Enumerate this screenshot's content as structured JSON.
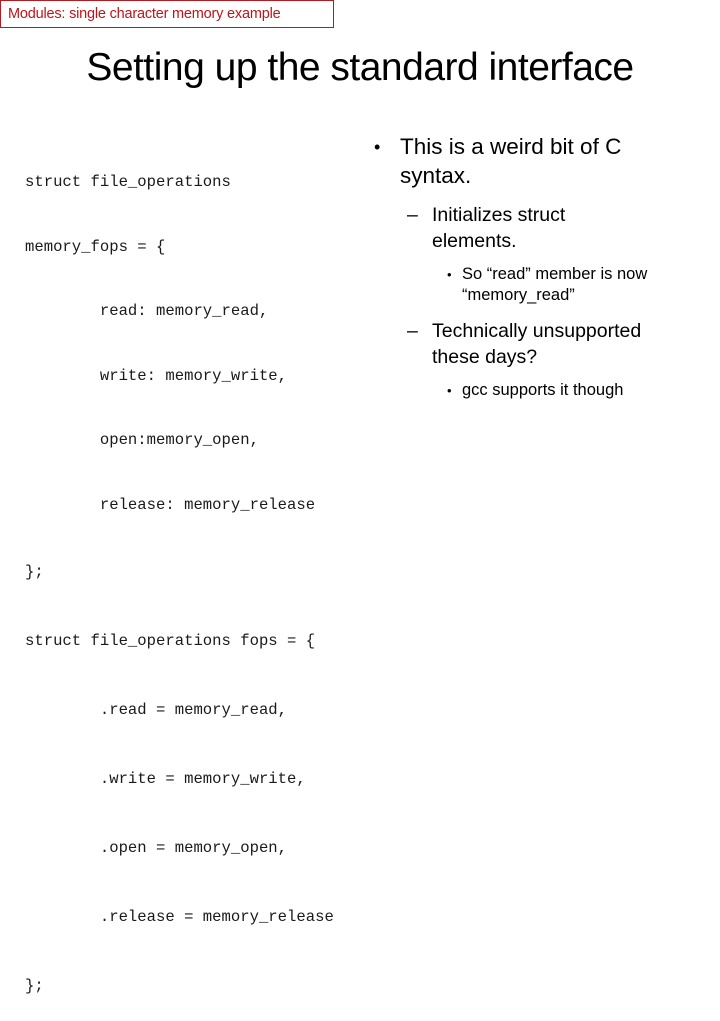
{
  "header": {
    "badge_text": "Modules: single character memory example",
    "title": "Setting up the standard interface"
  },
  "colors": {
    "badge_border": "#b01c22",
    "badge_text": "#c0131a",
    "text": "#000000",
    "background": "#ffffff"
  },
  "code": {
    "block1": [
      "struct file_operations",
      "memory_fops = {",
      "        read: memory_read,",
      "        write: memory_write,",
      "        open:memory_open,",
      "        release: memory_release",
      "};"
    ],
    "block2": [
      "struct file_operations fops = {",
      "        .read = memory_read,",
      "        .write = memory_write,",
      "        .open = memory_open,",
      "        .release = memory_release",
      "};"
    ]
  },
  "bullets": {
    "markers": {
      "level1": "•",
      "level2": "–",
      "level3": "•"
    },
    "items": [
      {
        "level": 1,
        "lines": [
          "This is a weird bit of C",
          "syntax."
        ]
      },
      {
        "level": 2,
        "lines": [
          "Initializes struct",
          "elements."
        ]
      },
      {
        "level": 3,
        "lines": [
          "So “read” member is now",
          "“memory_read”"
        ]
      },
      {
        "level": 2,
        "lines": [
          "Technically unsupported",
          "these days?"
        ]
      },
      {
        "level": 3,
        "lines": [
          "gcc supports it though"
        ]
      }
    ]
  }
}
